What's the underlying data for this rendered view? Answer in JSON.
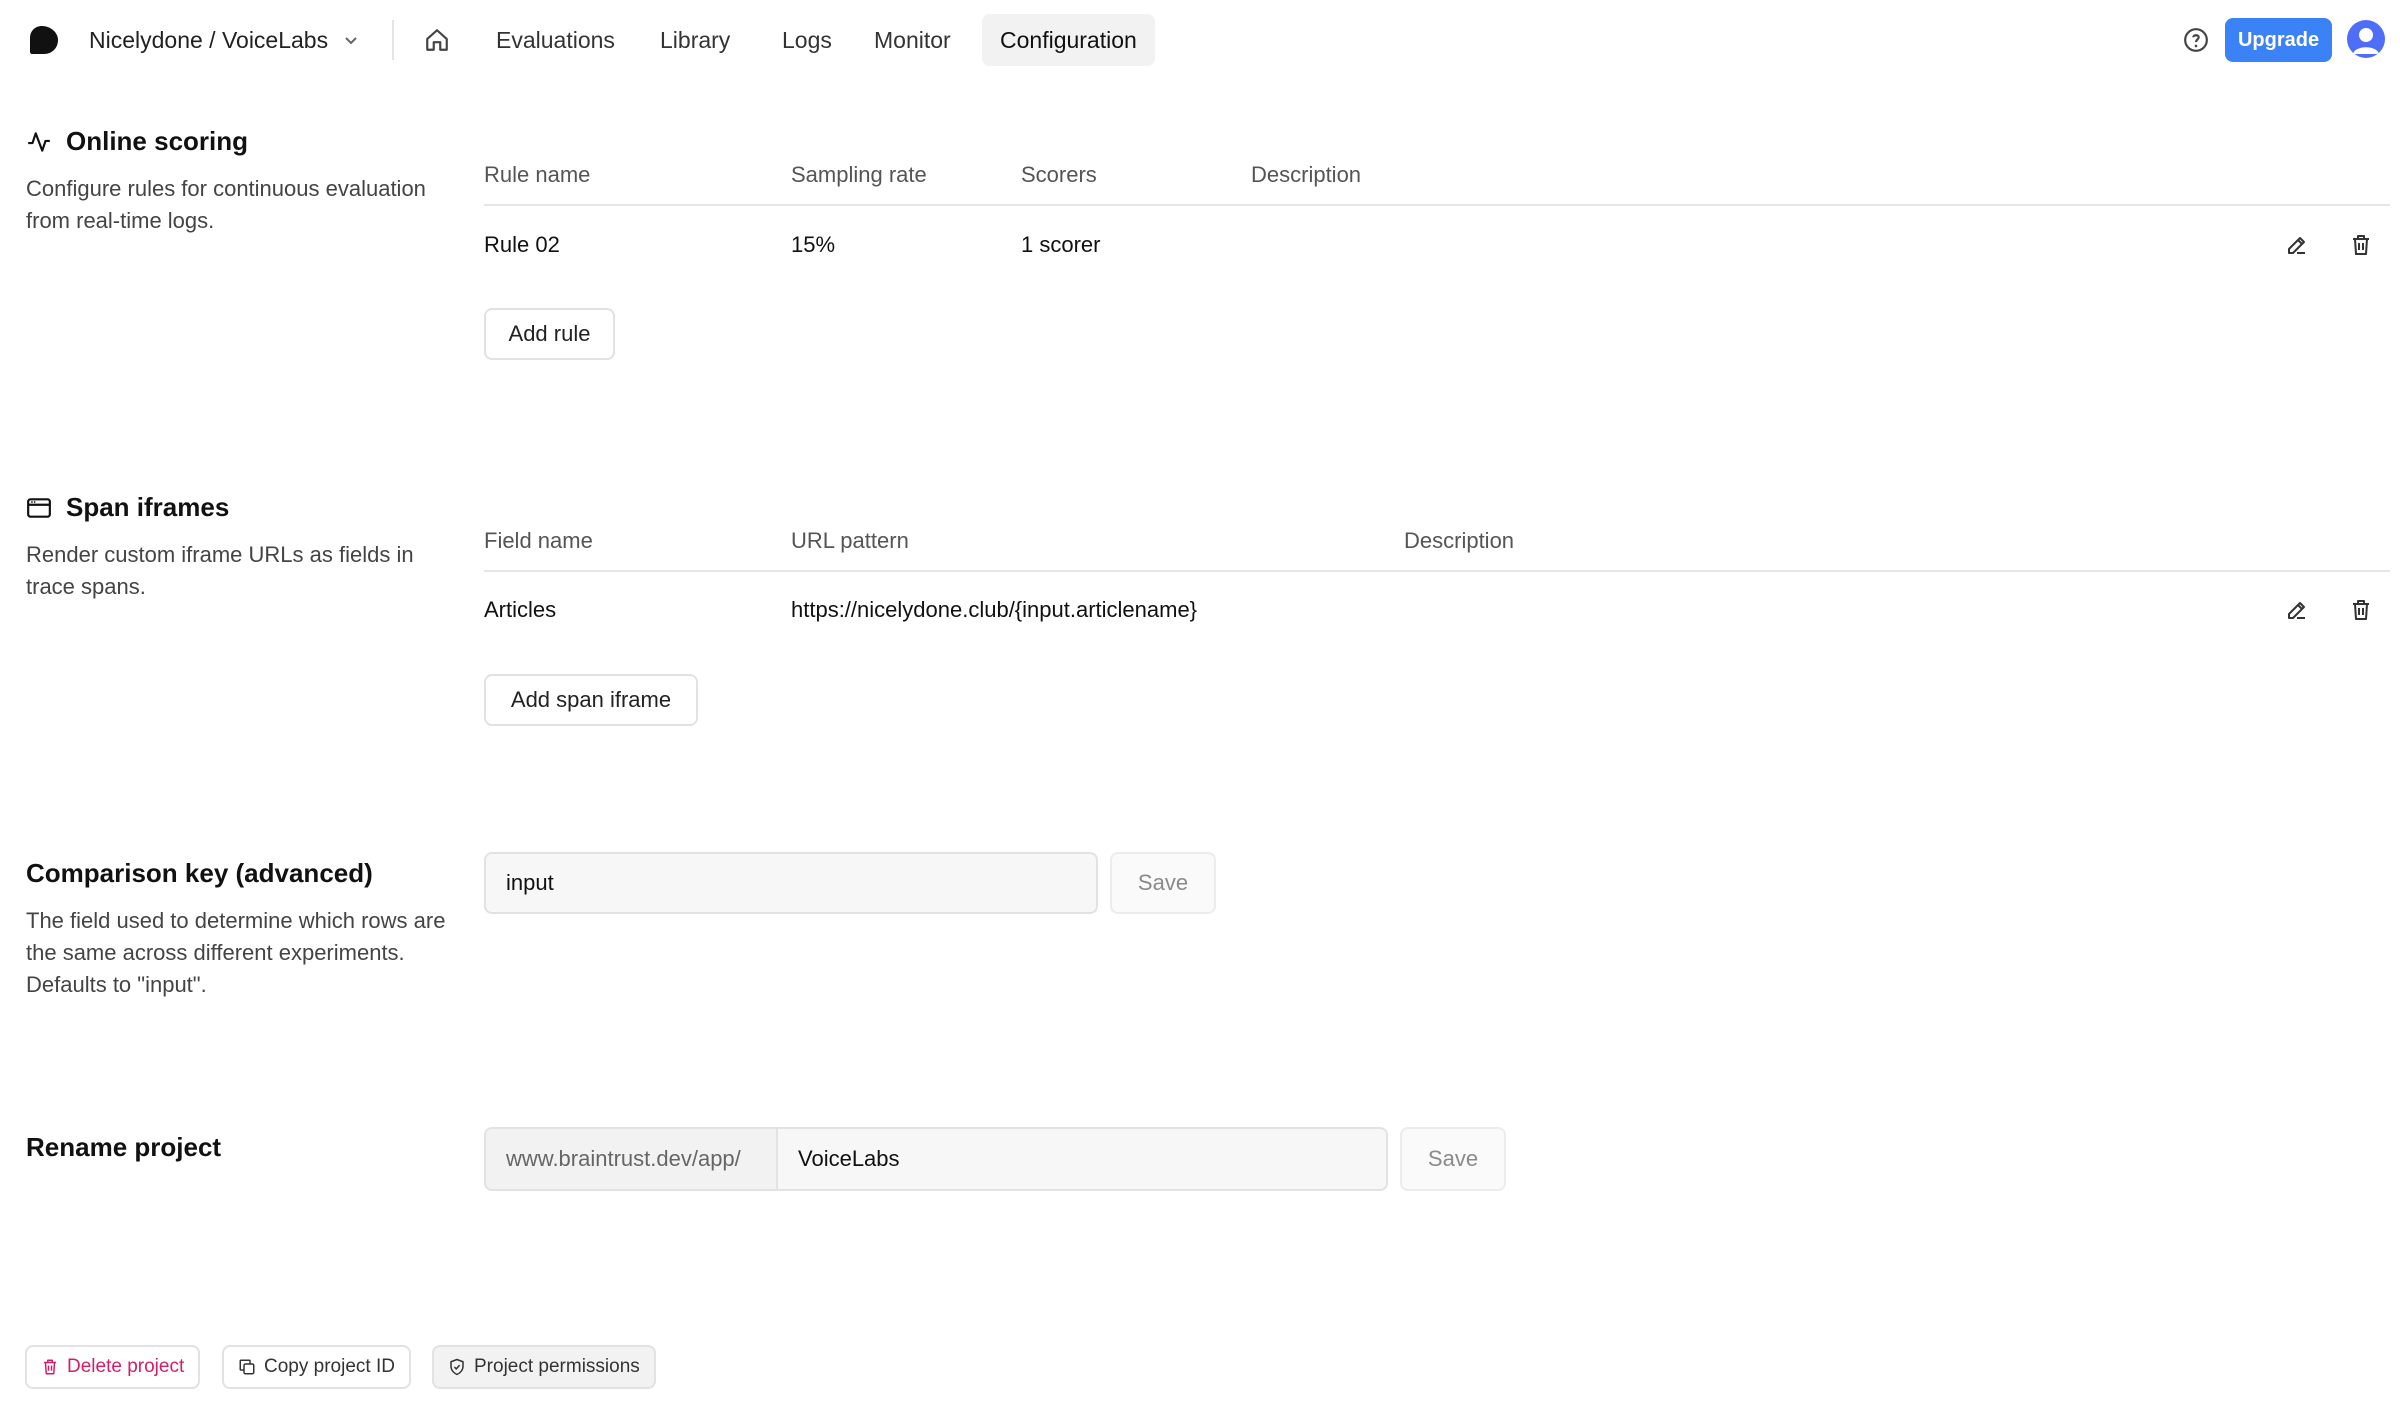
{
  "header": {
    "breadcrumb": "Nicelydone / VoiceLabs",
    "nav": [
      "Evaluations",
      "Library",
      "Logs",
      "Monitor",
      "Configuration"
    ],
    "active_nav": "Configuration",
    "upgrade_label": "Upgrade"
  },
  "online_scoring": {
    "title": "Online scoring",
    "description": "Configure rules for continuous evaluation from real-time logs.",
    "columns": [
      "Rule name",
      "Sampling rate",
      "Scorers",
      "Description"
    ],
    "rows": [
      {
        "rule_name": "Rule 02",
        "sampling_rate": "15%",
        "scorers": "1 scorer",
        "description": ""
      }
    ],
    "add_label": "Add rule"
  },
  "span_iframes": {
    "title": "Span iframes",
    "description": "Render custom iframe URLs as fields in trace spans.",
    "columns": [
      "Field name",
      "URL pattern",
      "Description"
    ],
    "rows": [
      {
        "field_name": "Articles",
        "url_pattern": "https://nicelydone.club/{input.articlename}",
        "description": ""
      }
    ],
    "add_label": "Add span iframe"
  },
  "comparison_key": {
    "title": "Comparison key (advanced)",
    "description": "The field used to determine which rows are the same across different experiments. Defaults to \"input\".",
    "value": "input",
    "save_label": "Save"
  },
  "rename_project": {
    "title": "Rename project",
    "prefix": "www.braintrust.dev/app/",
    "value": "VoiceLabs",
    "save_label": "Save"
  },
  "footer": {
    "delete_label": "Delete project",
    "copy_id_label": "Copy project ID",
    "permissions_label": "Project permissions"
  },
  "colors": {
    "accent": "#3b82f6",
    "danger": "#d11f6a"
  },
  "icons": [
    "logo-icon",
    "chevron-down-icon",
    "home-icon",
    "help-icon",
    "avatar-icon",
    "activity-icon",
    "window-icon",
    "edit-icon",
    "trash-icon",
    "copy-icon",
    "shield-icon"
  ]
}
